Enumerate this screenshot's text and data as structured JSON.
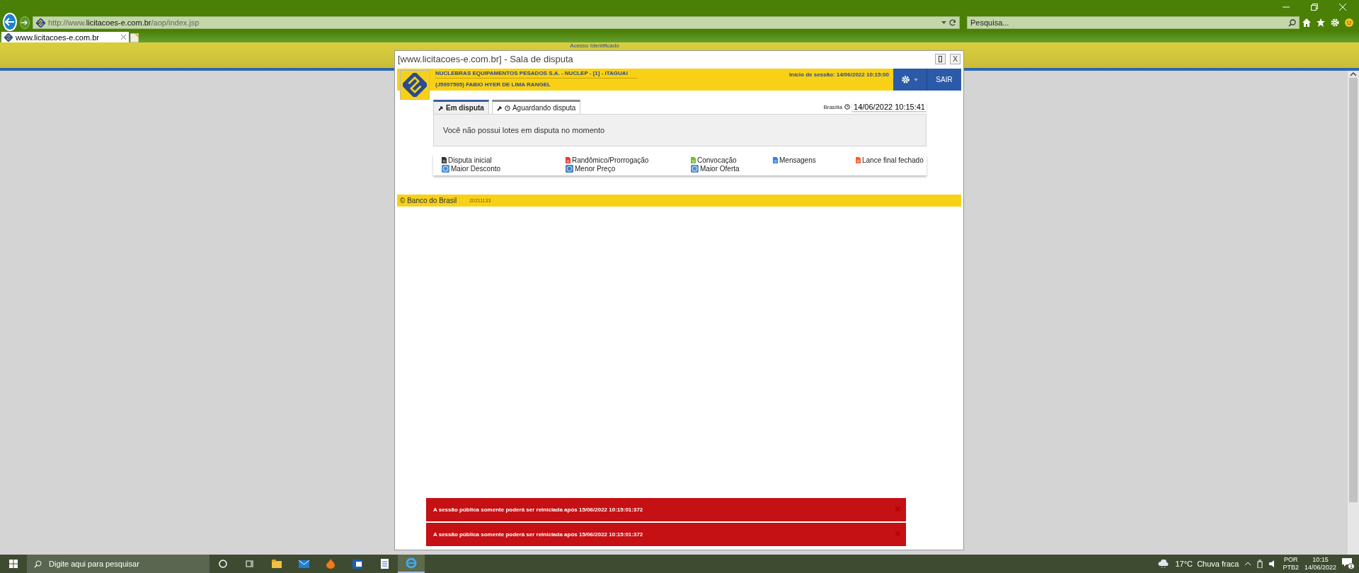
{
  "browser": {
    "url_prefix": "http://www.",
    "url_domain": "licitacoes-e.com.br",
    "url_path": "/aop/index.jsp",
    "search_placeholder": "Pesquisa...",
    "tabs": [
      {
        "label": "www.licitacoes-e.com.br",
        "selected": true
      }
    ]
  },
  "page": {
    "banner_label": "Acesso Identificado"
  },
  "dialog": {
    "title": "[www.licitacoes-e.com.br] - Sala de disputa",
    "close_label": "X",
    "header": {
      "org": "NUCLEBRAS EQUIPAMENTOS PESADOS S.A. - NUCLEP - [1] - ITAGUAI",
      "user": "(J5997595) FABIO HYER DE LIMA RANGEL",
      "session": "Início de sessão: 14/06/2022 10:15:00",
      "logout": "SAIR"
    },
    "tabs": [
      {
        "label": "Em disputa",
        "kind": "hammer",
        "selected": true
      },
      {
        "label": "Aguardando disputa",
        "kind": "hammer-clock",
        "selected": false
      }
    ],
    "clock": {
      "zone": "Brasília",
      "time": "14/06/2022 10:15:41"
    },
    "message": "Você não possui lotes em disputa no momento",
    "legend": [
      {
        "label": "Disputa inicial",
        "kind": "doc",
        "color": "#333333"
      },
      {
        "label": "Randômico/Prorrogação",
        "kind": "doc",
        "color": "#e53935"
      },
      {
        "label": "Convocação",
        "kind": "doc",
        "color": "#6cbf2e"
      },
      {
        "label": "Mensagens",
        "kind": "doc",
        "color": "#2f80ed"
      },
      {
        "label": "Lance final fechado",
        "kind": "doc",
        "color": "#f0612a"
      },
      {
        "label": "Maior Desconto",
        "kind": "globe",
        "color": "#4a90d9"
      },
      {
        "label": "Menor Preço",
        "kind": "globe",
        "color": "#3f7fc4"
      },
      {
        "label": "Maior Oferta",
        "kind": "globe",
        "color": "#5a8fc8"
      }
    ],
    "footer": {
      "copyright": "© Banco do Brasil",
      "version": "20211133"
    },
    "alerts": [
      {
        "text": "A sessão pública somente poderá ser reiniciada após 15/06/2022 10:15:01:372"
      },
      {
        "text": "A sessão pública somente poderá ser reiniciada após 15/06/2022 10:15:01:372"
      }
    ]
  },
  "taskbar": {
    "search_placeholder": "Digite aqui para pesquisar",
    "apps": [
      {
        "kind": "explorer",
        "selected": false
      },
      {
        "kind": "mail",
        "selected": false
      },
      {
        "kind": "flame",
        "selected": false
      },
      {
        "kind": "outlook",
        "selected": false
      },
      {
        "kind": "notes",
        "selected": false
      },
      {
        "kind": "ie",
        "selected": true
      }
    ],
    "weather": "17°C  Chuva fraca",
    "language": "POR",
    "layout": "PTB2",
    "time": "10:15",
    "date": "14/06/2022",
    "notifications": "1"
  }
}
